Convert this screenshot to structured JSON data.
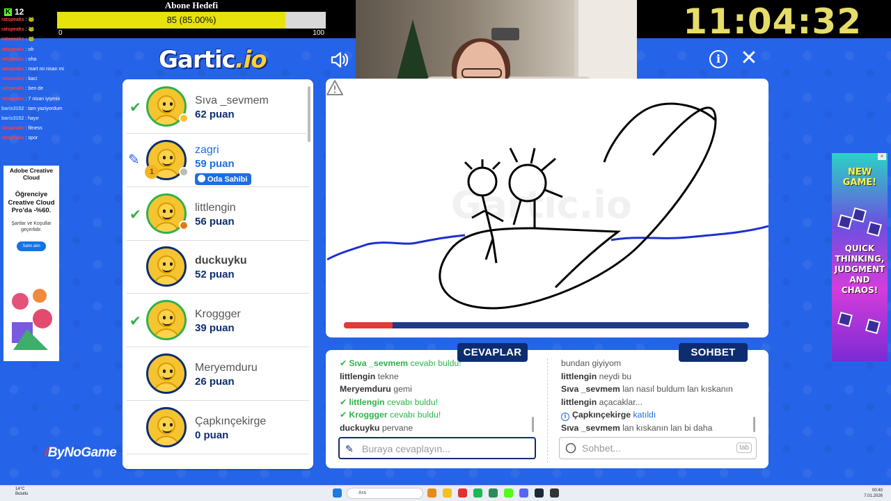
{
  "stream": {
    "kick_count": "12",
    "goal_title": "Abone Hedefi",
    "goal_progress_text": "85 (85.00%)",
    "goal_progress_fraction": 0.85,
    "goal_min": "0",
    "goal_max": "100",
    "clock": "11:04:32",
    "overlay_chat": [
      {
        "user": "ratspeaks",
        "text": "🐸"
      },
      {
        "user": "ratspeaks",
        "text": "🐸"
      },
      {
        "user": "ratspeaks",
        "text": "🐸"
      },
      {
        "user": "ratspeaks",
        "text": "oh"
      },
      {
        "user": "ratspeaks",
        "text": "oha"
      },
      {
        "user": "ratspeaks",
        "text": "mart mi nisan mi"
      },
      {
        "user": "ratspeaks",
        "text": "kaci"
      },
      {
        "user": "ratspeaks",
        "text": "ben de"
      },
      {
        "user": "ratspeaks",
        "text": "7 nisan iyiymis"
      },
      {
        "user": "baris3152",
        "text": "tam yaziyordum",
        "blue": true
      },
      {
        "user": "baris3152",
        "text": "hayır",
        "blue": true
      },
      {
        "user": "ratspeaks",
        "text": "fitness"
      },
      {
        "user": "ratspeaks",
        "text": "spor"
      }
    ],
    "watermark": "ByNoGame"
  },
  "game": {
    "logo_main": "Gartic",
    "logo_suffix": ".io",
    "sound_icon": "speaker-icon",
    "info_icon": "info-icon",
    "close_icon": "close-icon"
  },
  "players": [
    {
      "name": "Sıva _sevmem",
      "score": "62 puan",
      "status": "guessed",
      "dot": "#f5c430"
    },
    {
      "name": "zagri",
      "score": "59 puan",
      "status": "drawing",
      "dot": "#bbbbbb",
      "badge": "Oda Sahibi",
      "trophy": "1"
    },
    {
      "name": "littlengin",
      "score": "56 puan",
      "status": "guessed",
      "dot": "#e07a18"
    },
    {
      "name": "duckuyku",
      "score": "52 puan",
      "status": "none",
      "bold": true
    },
    {
      "name": "Kroggger",
      "score": "39 puan",
      "status": "guessed"
    },
    {
      "name": "Meryemduru",
      "score": "26 puan",
      "status": "none"
    },
    {
      "name": "Çapkınçekirge",
      "score": "0 puan",
      "status": "none"
    }
  ],
  "canvas": {
    "timer_fraction": 0.12
  },
  "tabs": {
    "answers": "CEVAPLAR",
    "chat": "SOHBET"
  },
  "answers": [
    {
      "type": "correct",
      "user": "Sıva _sevmem",
      "text": "cevabı buldu!"
    },
    {
      "type": "msg",
      "user": "littlengin",
      "text": "tekne"
    },
    {
      "type": "msg",
      "user": "Meryemduru",
      "text": "gemi"
    },
    {
      "type": "correct",
      "user": "littlengin",
      "text": "cevabı buldu!"
    },
    {
      "type": "correct",
      "user": "Kroggger",
      "text": "cevabı buldu!"
    },
    {
      "type": "msg",
      "user": "duckuyku",
      "text": "pervane"
    }
  ],
  "chat": [
    {
      "type": "plain",
      "user": "",
      "text": "bundan giyiyom"
    },
    {
      "type": "msg",
      "user": "littlengin",
      "text": "neydi bu"
    },
    {
      "type": "msg",
      "user": "Sıva _sevmem",
      "text": "lan nasıl buldum lan kıskanın"
    },
    {
      "type": "msg",
      "user": "littlengin",
      "text": "açacaklar..."
    },
    {
      "type": "join",
      "user": "Çapkınçekirge",
      "text": "katıldı"
    },
    {
      "type": "msg",
      "user": "Sıva _sevmem",
      "text": "lan kıskanın lan bi daha"
    }
  ],
  "answer_input": {
    "placeholder": "Buraya cevaplayın...",
    "value": ""
  },
  "chat_input": {
    "placeholder": "Sohbet...",
    "value": "",
    "key_hint": "tab"
  },
  "ads": {
    "left": {
      "brand": "Adobe Creative Cloud",
      "headline": "Öğrenciye Creative Cloud Pro'da -%60.",
      "terms": "Şartlar ve Koşullar geçerlidir.",
      "cta": "Satın alın"
    },
    "right": {
      "top": "NEW GAME!",
      "bottom": "QUICK THINKING, JUDGMENT AND CHAOS!"
    }
  },
  "taskbar": {
    "weather_temp": "14°C",
    "weather_desc": "Bulutlu",
    "search": "Ara",
    "time": "00:40",
    "date": "7.01.2026"
  }
}
